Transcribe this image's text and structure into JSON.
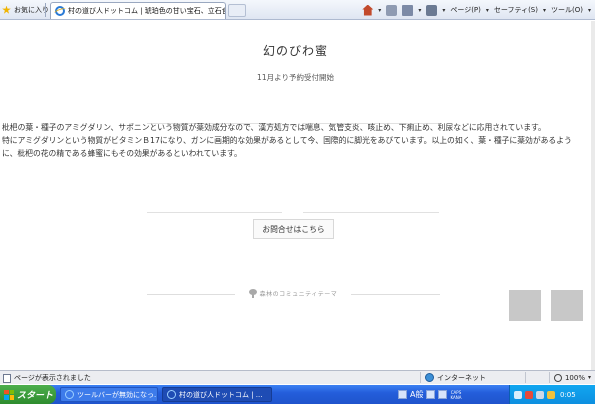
{
  "browser": {
    "favorites_label": "お気に入り",
    "tab_title": "村の道び人ドットコム | 琥珀色の甘い宝石、立石食蜂...",
    "toolbar": {
      "page_menu": "ページ(P)",
      "safety_menu": "セーフティ(S)",
      "tools_menu": "ツール(O)"
    }
  },
  "page": {
    "title": "幻のびわ蜜",
    "subtitle": "11月より予約受付開始",
    "paragraphs": [
      "枇杷の葉・種子のアミグダリン、サポニンという物質が薬効成分なので、漢方処方では喘息、気管支炎、咳止め、下痢止め、利尿などに応用されています。",
      "特にアミグダリンという物質がビタミンＢ17になり、ガンに画期的な効果があるとして今、国際的に脚光をあびています。以上の如く、葉・種子に薬効があるように、枇杷の花の精である蜂蜜にもその効果があるといわれています。"
    ],
    "contact_button": "お問合せはこちら",
    "footer_label": "森林のコミュニティテーマ"
  },
  "statusbar": {
    "message": "ページが表示されました",
    "zone": "インターネット",
    "zoom": "100%"
  },
  "taskbar": {
    "start": "スタート",
    "buttons": [
      "ツールバーが無効になっ...",
      "村の道び人ドットコム | ..."
    ],
    "ime": "A般",
    "caps": "CAPS",
    "kana": "KANA",
    "clock": "0:05"
  }
}
